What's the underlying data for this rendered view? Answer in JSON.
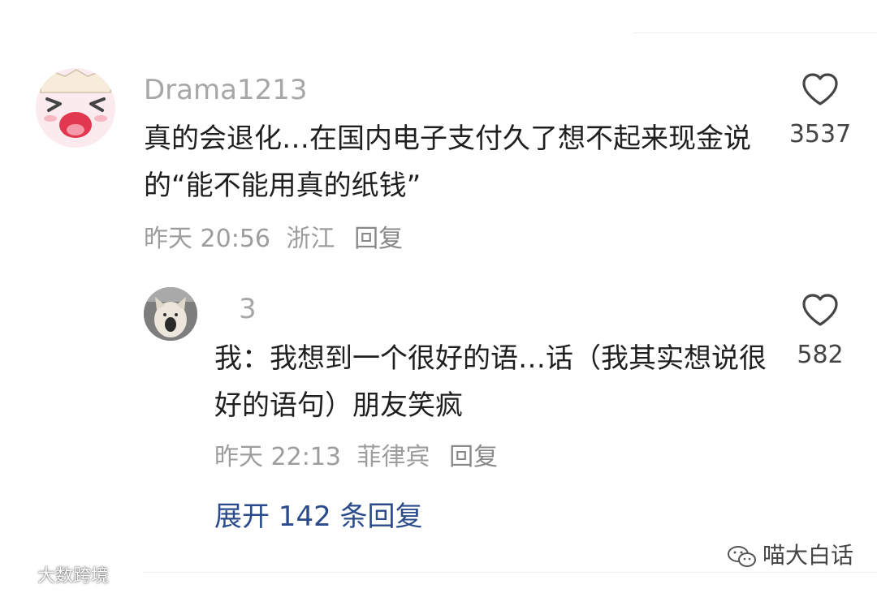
{
  "comments": [
    {
      "username": "Drama1213",
      "text": "真的会退化…在国内电子支付久了想不起来现金说的“能不能用真的纸钱”",
      "time": "昨天 20:56",
      "location": "浙江",
      "reply_label": "回复",
      "likes": "3537",
      "avatar_icon": "cartoon-laughing-face-avatar"
    },
    {
      "username": "3",
      "text": "我：我想到一个很好的语…话（我其实想说很好的语句）朋友笑疯",
      "time": "昨天 22:13",
      "location": "菲律宾",
      "reply_label": "回复",
      "likes": "582",
      "avatar_icon": "dog-photo-avatar"
    }
  ],
  "expand_replies": "展开 142 条回复",
  "watermark_left": "大数跨境",
  "watermark_right": "喵大白话",
  "icons": {
    "like": "heart-outline-icon",
    "watermark_left": "weibo-icon",
    "watermark_right": "wechat-icon"
  },
  "colors": {
    "username": "#a7a7a7",
    "text": "#1f1f1f",
    "meta": "#9d9d9d",
    "expand_link": "#2a4a8b"
  }
}
